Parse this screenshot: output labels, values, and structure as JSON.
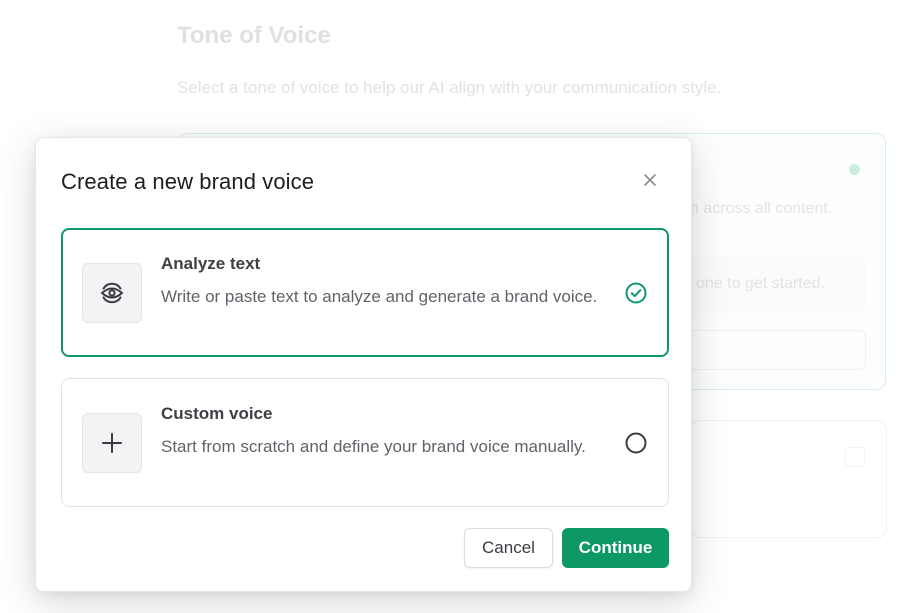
{
  "background": {
    "title": "Tone of Voice",
    "subtitle": "Select a tone of voice to help our AI align with your communication style.",
    "card_line": "n across all content.",
    "hint_text": "one to get started."
  },
  "modal": {
    "title": "Create a new brand voice",
    "close_icon": "close-icon",
    "options": [
      {
        "title": "Analyze text",
        "description": "Write or paste text to analyze and generate a brand voice.",
        "icon": "eye-scan-icon",
        "selected": true
      },
      {
        "title": "Custom voice",
        "description": "Start from scratch and define your brand voice manually.",
        "icon": "plus-icon",
        "selected": false
      }
    ],
    "cancel_label": "Cancel",
    "continue_label": "Continue"
  },
  "colors": {
    "accent": "#0e9865",
    "accent_light": "#d7f0e4",
    "text_primary": "#1d1d22",
    "text_secondary": "#62626a"
  }
}
